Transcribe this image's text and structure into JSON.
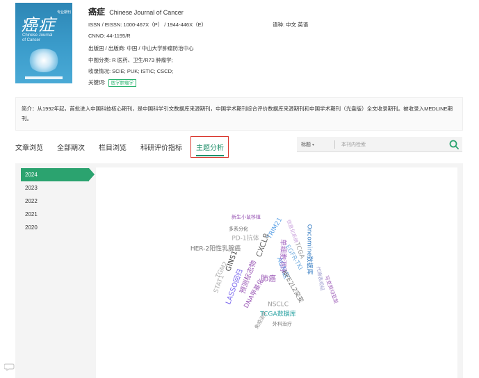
{
  "cover": {
    "title": "癌症",
    "label": "专业期刊",
    "english": "Chinese Journal of Cancer"
  },
  "journal": {
    "title_cn": "癌症",
    "title_en": "Chinese Journal of Cancer",
    "issn": "ISSN / EISSN:  1000-467X（P） / 1944-446X（E）",
    "cnno": "CNNO:  44-1195/R",
    "publisher": "出版国 / 出版商:  中国 / 中山大学肿瘤防治中心",
    "classification": "中图分类:  R 医药、卫生/R73 肿瘤学;",
    "indexing": "收录情况:  SCIE;  PUK;  ISTIC;  CSCD;",
    "keyword_label": "关键词:",
    "keyword_tag": "医学肿瘤学",
    "language": "语种:  中文  英语"
  },
  "intro": "简介：从1992年起，首批进入中国科技核心期刊，是中国科学引文数据库来源期刊，中国学术期刊综合评价数据库来源期刊和中国学术期刊（光盘版）全文收录期刊。被收录入MEDLINE期刊。",
  "tabs": [
    {
      "label": "文章浏览"
    },
    {
      "label": "全部期次"
    },
    {
      "label": "栏目浏览"
    },
    {
      "label": "科研评价指标"
    },
    {
      "label": "主题分析"
    }
  ],
  "search": {
    "select_value": "标题",
    "placeholder": "本刊内检索"
  },
  "years": [
    "2024",
    "2023",
    "2022",
    "2021",
    "2020"
  ],
  "word_cloud": [
    {
      "text": "新生小鼠移植",
      "color": "#9b59b6"
    },
    {
      "text": "TRIM21",
      "color": "#5aa0e6"
    },
    {
      "text": "多系分化",
      "color": "#666666"
    },
    {
      "text": "PD-1抗体",
      "color": "#aaaaaa"
    },
    {
      "text": "信息化系统",
      "color": "#c9a0dc"
    },
    {
      "text": "CXCL8",
      "color": "#666666"
    },
    {
      "text": "HER-2阳性乳腺癌",
      "color": "#777777"
    },
    {
      "text": "TCGA",
      "color": "#a0a0a0"
    },
    {
      "text": "Oncomine数据库",
      "color": "#3a7fc4"
    },
    {
      "text": "GINS1",
      "color": "#444444"
    },
    {
      "text": "肺癌",
      "color": "#9b59b6"
    },
    {
      "text": "AGM区",
      "color": "#5aa0e6"
    },
    {
      "text": "预测标志物",
      "color": "#9b59b6"
    },
    {
      "text": "单细胞测序",
      "color": "#a060c0"
    },
    {
      "text": "LASSO回归",
      "color": "#7b68ee"
    },
    {
      "text": "DNA甲基化",
      "color": "#9b59b6"
    },
    {
      "text": "NFE2L2突变",
      "color": "#777777"
    },
    {
      "text": "NSCLC",
      "color": "#999999"
    },
    {
      "text": "TCGA数据库",
      "color": "#2ba3a3"
    },
    {
      "text": "外科治疗",
      "color": "#777777"
    },
    {
      "text": "免疫治疗",
      "color": "#888888"
    },
    {
      "text": "TGM2",
      "color": "#b0b0b0"
    },
    {
      "text": "STAT1",
      "color": "#b0b0b0"
    },
    {
      "text": "可变剪切亚型",
      "color": "#9b59b6"
    },
    {
      "text": "代谢表观组",
      "color": "#a0a0d0"
    },
    {
      "text": "EGFR-TKI",
      "color": "#7ab0e0"
    }
  ]
}
